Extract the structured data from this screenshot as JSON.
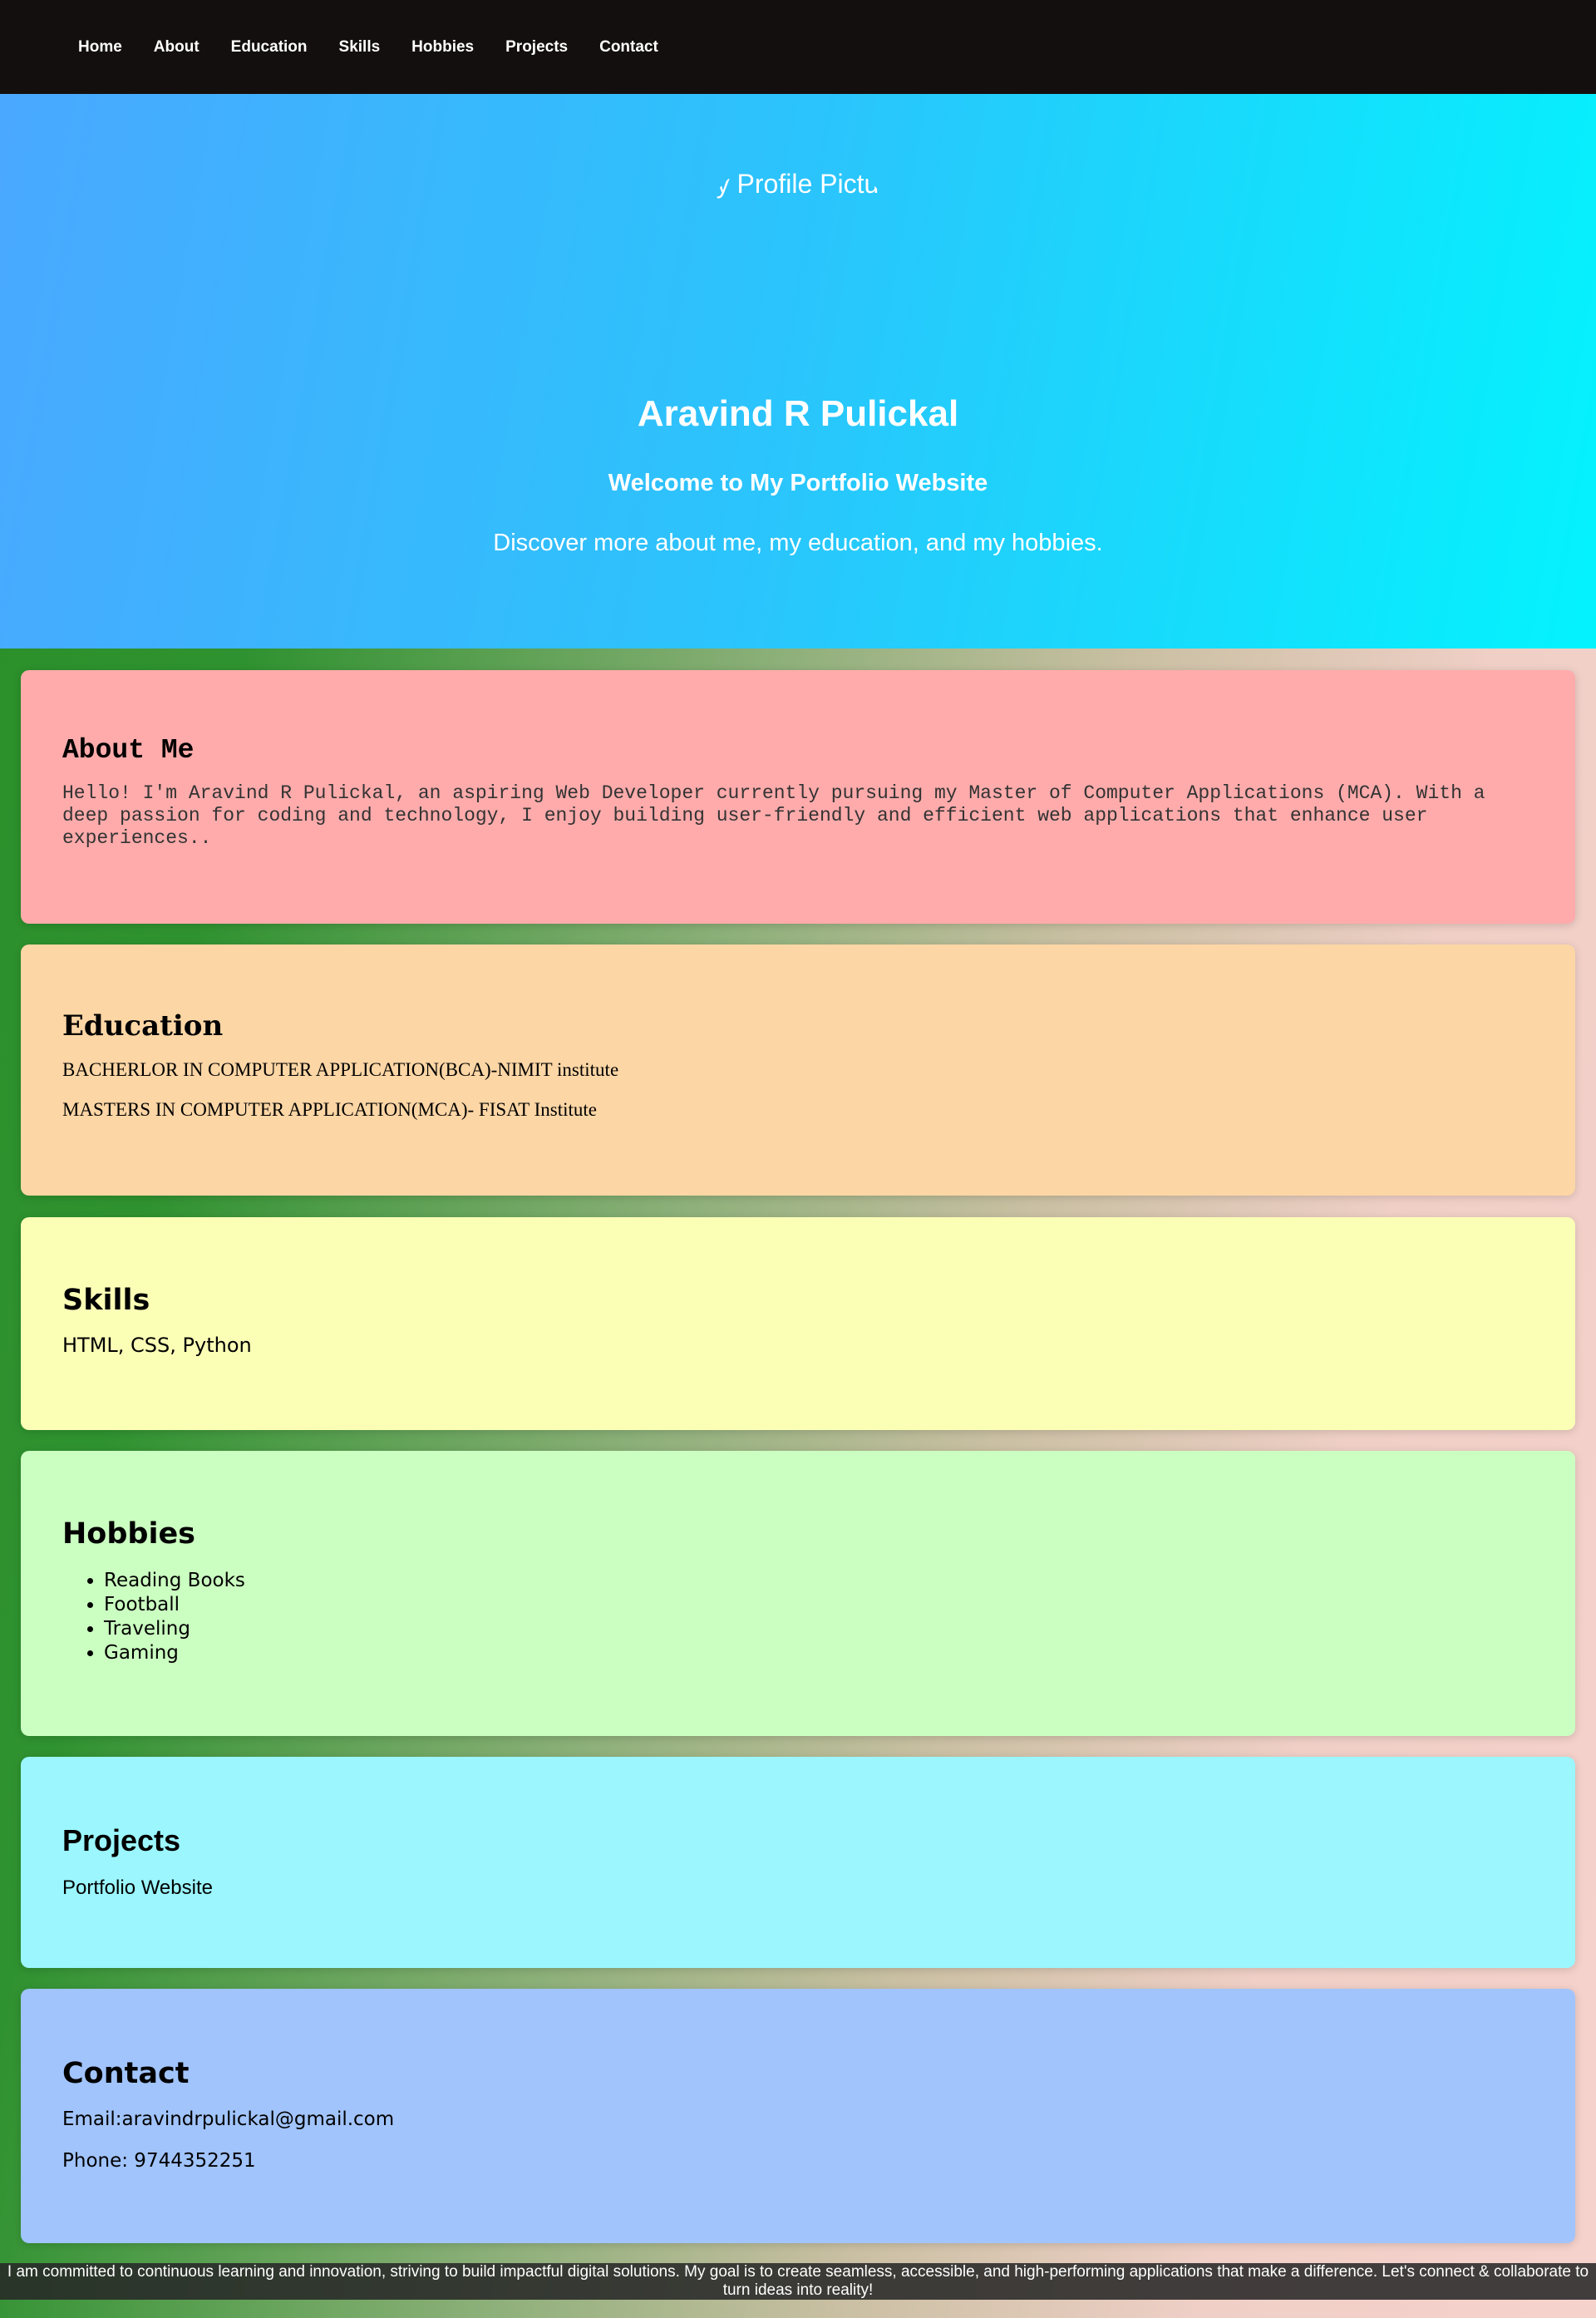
{
  "nav": {
    "items": [
      "Home",
      "About",
      "Education",
      "Skills",
      "Hobbies",
      "Projects",
      "Contact"
    ]
  },
  "hero": {
    "profile_alt": "My Profile Picture",
    "name": "Aravind R Pulickal",
    "welcome": "Welcome to My Portfolio Website",
    "tagline": "Discover more about me, my education, and my hobbies."
  },
  "about": {
    "title": "About Me",
    "text": "Hello! I'm Aravind R Pulickal, an aspiring Web Developer currently pursuing my Master of Computer Applications (MCA). With a deep passion for coding and technology, I enjoy building user-friendly and efficient web applications that enhance user experiences.."
  },
  "education": {
    "title": "Education",
    "items": [
      "BACHERLOR IN COMPUTER APPLICATION(BCA)-NIMIT institute",
      "MASTERS IN COMPUTER APPLICATION(MCA)- FISAT Institute"
    ]
  },
  "skills": {
    "title": "Skills",
    "text": "HTML, CSS, Python"
  },
  "hobbies": {
    "title": "Hobbies",
    "items": [
      "Reading Books",
      "Football",
      "Traveling",
      "Gaming"
    ]
  },
  "projects": {
    "title": "Projects",
    "text": "Portfolio Website"
  },
  "contact": {
    "title": "Contact",
    "email": "Email:aravindrpulickal@gmail.com",
    "phone": "Phone: 9744352251"
  },
  "footer": {
    "text": "I am committed to continuous learning and innovation, striving to build impactful digital solutions. My goal is to create seamless, accessible, and high-performing applications that make a difference. Let's connect & collaborate to turn ideas into reality!"
  }
}
